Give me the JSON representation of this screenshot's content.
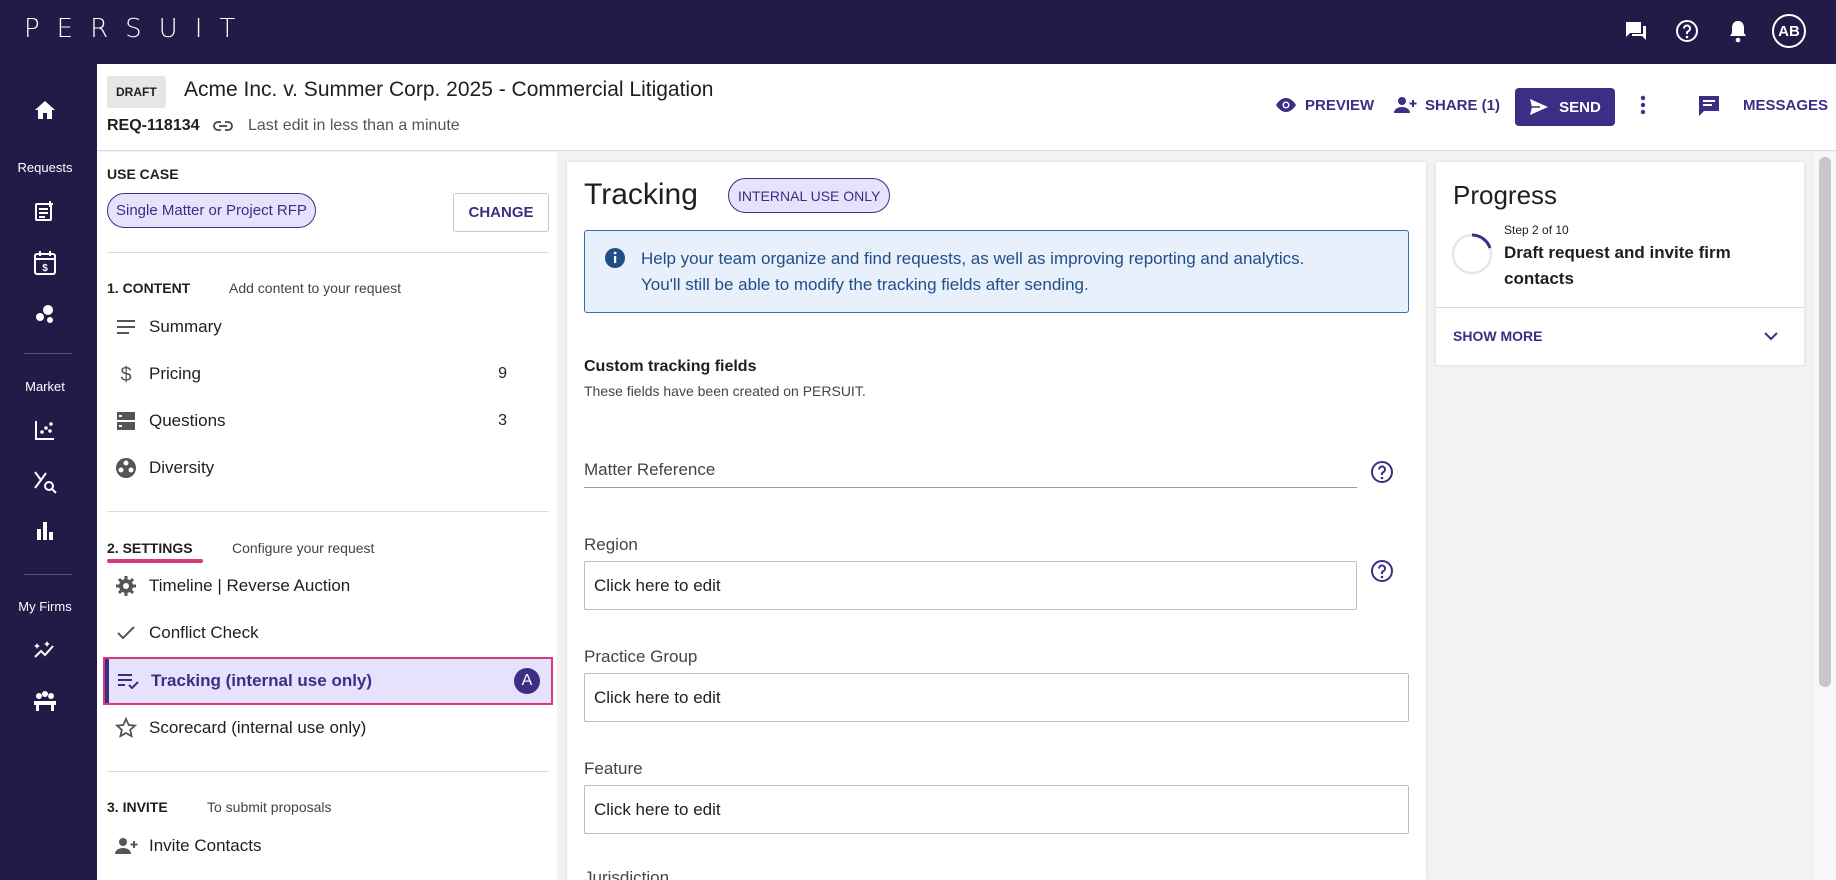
{
  "topbar": {
    "logo": "PERSUIT",
    "avatar": "AB",
    "icons": [
      "chat-icon",
      "help-icon",
      "notifications-icon"
    ]
  },
  "rail": {
    "requests_label": "Requests",
    "market_label": "Market",
    "myfirms_label": "My Firms"
  },
  "header": {
    "draft_badge": "DRAFT",
    "title": "Acme Inc. v. Summer Corp. 2025 - Commercial Litigation",
    "req_id": "REQ-118134",
    "last_edit": "Last edit in less than a minute",
    "preview_label": "PREVIEW",
    "share_label": "SHARE (1)",
    "send_label": "SEND",
    "messages_label": "MESSAGES"
  },
  "left": {
    "use_case_label": "USE CASE",
    "use_case_value": "Single Matter or Project RFP",
    "change_label": "CHANGE",
    "content_label": "1. CONTENT",
    "content_sub": "Add content to your request",
    "content_items": [
      {
        "label": "Summary",
        "count": ""
      },
      {
        "label": "Pricing",
        "count": "9"
      },
      {
        "label": "Questions",
        "count": "3"
      },
      {
        "label": "Diversity",
        "count": ""
      }
    ],
    "settings_label": "2. SETTINGS",
    "settings_sub": "Configure your request",
    "settings_items": [
      {
        "label": "Timeline | Reverse Auction"
      },
      {
        "label": "Conflict Check"
      },
      {
        "label": "Tracking (internal use only)",
        "badge": "A"
      },
      {
        "label": "Scorecard (internal use only)"
      }
    ],
    "invite_label": "3. INVITE",
    "invite_sub": "To submit proposals",
    "invite_items": [
      {
        "label": "Invite Contacts"
      }
    ]
  },
  "main": {
    "title": "Tracking",
    "chip": "INTERNAL USE ONLY",
    "info_line1": "Help your team organize and find requests, as well as improving reporting and analytics.",
    "info_line2": "You'll still be able to modify the tracking fields after sending.",
    "custom_title": "Custom tracking fields",
    "custom_sub": "These fields have been created on PERSUIT.",
    "fields": [
      {
        "label": "Matter Reference",
        "value": ""
      },
      {
        "label": "Region",
        "value": "Click here to edit"
      },
      {
        "label": "Practice Group",
        "value": "Click here to edit"
      },
      {
        "label": "Feature",
        "value": "Click here to edit"
      },
      {
        "label": "Jurisdiction",
        "value": ""
      }
    ]
  },
  "progress": {
    "title": "Progress",
    "step": "Step 2 of 10",
    "desc": "Draft request and invite firm contacts",
    "show_more": "SHOW MORE"
  },
  "colors": {
    "nav_bg": "#221b48",
    "accent": "#3b2f85",
    "highlight": "#d63a7e",
    "chip_bg": "#e6e2fb",
    "info_bg": "#e8f0fb"
  }
}
